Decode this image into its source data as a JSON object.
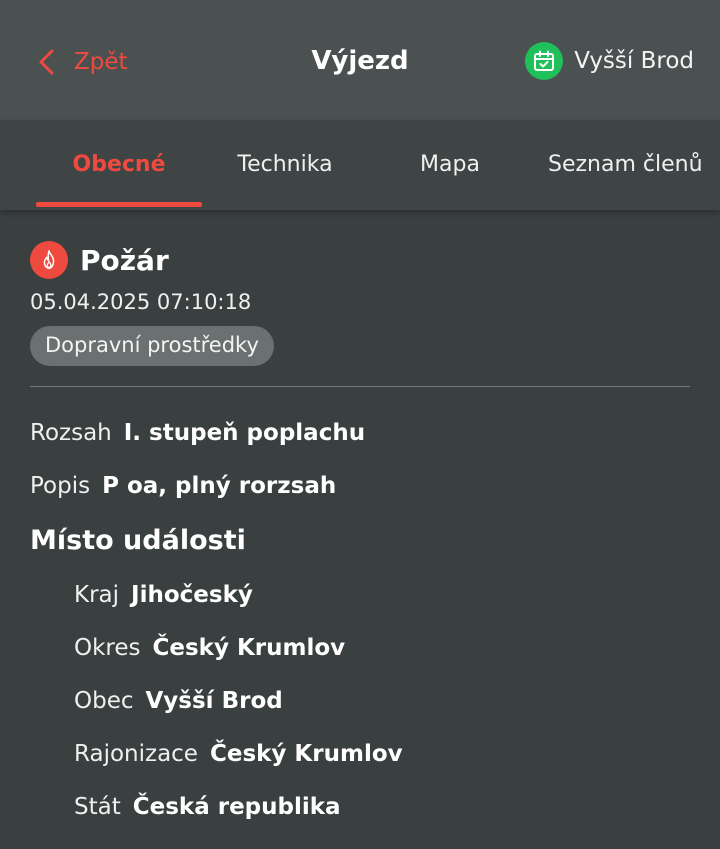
{
  "header": {
    "back_label": "Zpět",
    "title": "Výjezd",
    "station_label": "Vyšší Brod"
  },
  "tabs": [
    {
      "label": "Obecné",
      "active": true
    },
    {
      "label": "Technika",
      "active": false
    },
    {
      "label": "Mapa",
      "active": false
    },
    {
      "label": "Seznam členů",
      "active": false
    }
  ],
  "event": {
    "icon": "fire-icon",
    "type": "Požár",
    "datetime": "05.04.2025 07:10:18",
    "badge": "Dopravní prostředky"
  },
  "details": {
    "rozsah": {
      "key": "Rozsah",
      "value": "I. stupeň poplachu"
    },
    "popis": {
      "key": "Popis",
      "value": "P oa, plný rorzsah"
    }
  },
  "location": {
    "title": "Místo události",
    "fields": [
      {
        "key": "Kraj",
        "value": "Jihočeský"
      },
      {
        "key": "Okres",
        "value": "Český Krumlov"
      },
      {
        "key": "Obec",
        "value": "Vyšší Brod"
      },
      {
        "key": "Rajonizace",
        "value": "Český Krumlov"
      },
      {
        "key": "Stát",
        "value": "Česká republika"
      }
    ]
  },
  "colors": {
    "accent": "#ef4a3f",
    "station": "#1fbf5a",
    "background": "#3a3f3f",
    "header": "#4b5051"
  }
}
